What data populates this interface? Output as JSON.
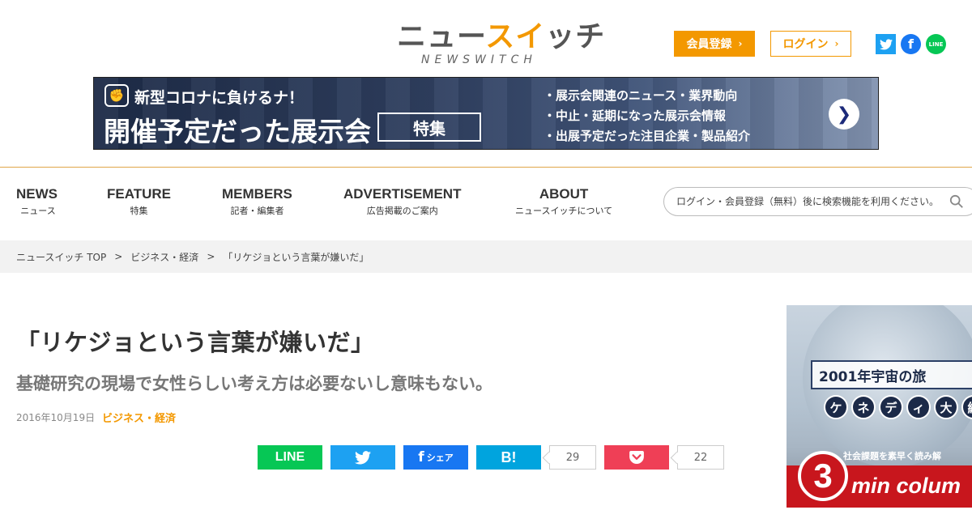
{
  "header": {
    "logo_main_a": "ニュー",
    "logo_main_b": "スイ",
    "logo_main_c": "ッチ",
    "logo_sub": "NEWSWITCH",
    "member_label": "会員登録",
    "login_label": "ログイン",
    "sns": {
      "line_label": "LINE"
    }
  },
  "banner": {
    "line1": "新型コロナに負けるナ！",
    "line2": "開催予定だった展示会",
    "tag": "特集",
    "bullets": [
      "・展示会関連のニュース・業界動向",
      "・中止・延期になった展示会情報",
      "・出展予定だった注目企業・製品紹介"
    ]
  },
  "nav": {
    "items": [
      {
        "en": "NEWS",
        "ja": "ニュース"
      },
      {
        "en": "FEATURE",
        "ja": "特集"
      },
      {
        "en": "MEMBERS",
        "ja": "記者・編集者"
      },
      {
        "en": "ADVERTISEMENT",
        "ja": "広告掲載のご案内"
      },
      {
        "en": "ABOUT",
        "ja": "ニュースイッチについて"
      }
    ],
    "search_placeholder": "ログイン・会員登録（無料）後に検索機能を利用ください。"
  },
  "breadcrumb": {
    "items": [
      "ニュースイッチ TOP",
      "ビジネス・経済",
      "「リケジョという言葉が嫌いだ」"
    ],
    "separator": ">"
  },
  "article": {
    "title": "「リケジョという言葉が嫌いだ」",
    "subtitle": "基礎研究の現場で女性らしい考え方は必要ないし意味もない。",
    "date": "2016年10月19日",
    "category": "ビジネス・経済"
  },
  "share": {
    "line_label": "LINE",
    "fb_label": "シェア",
    "hatena_label": "B!",
    "hatena_count": "29",
    "pocket_count": "22"
  },
  "side_ad": {
    "headline": "2001年宇宙の旅",
    "kana": [
      "ケ",
      "ネ",
      "デ",
      "ィ",
      "大",
      "統"
    ],
    "small": "社会課題を素早く読み解",
    "number": "3",
    "brand": "min colum"
  },
  "colors": {
    "accent": "#f39800",
    "twitter": "#1da1f2",
    "facebook": "#1877f2",
    "line": "#06c755",
    "hatena": "#00a4de",
    "pocket": "#ef3f56"
  }
}
